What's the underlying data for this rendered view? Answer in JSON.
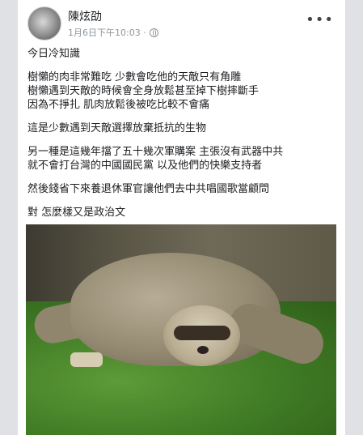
{
  "post": {
    "author": "陳炫劭",
    "timestamp": "1月6日下午10:03 ·",
    "more_label": "•••",
    "paragraphs": [
      "今日冷知識",
      "樹懶的肉非常難吃 少數會吃他的天敵只有角雕\n樹懶遇到天敵的時候會全身放鬆甚至掉下樹摔斷手\n因為不掙扎 肌肉放鬆後被吃比較不會痛",
      "這是少數遇到天敵選擇放棄抵抗的生物",
      "另一種是這幾年擋了五十幾次軍購案 主張沒有武器中共\n就不會打台灣的中國國民黨 以及他們的快樂支持者",
      "然後錢省下來養退休軍官讓他們去中共唱國歌當顧問",
      "對 怎麼樣又是政治文"
    ],
    "privacy_icon": "globe-icon"
  }
}
